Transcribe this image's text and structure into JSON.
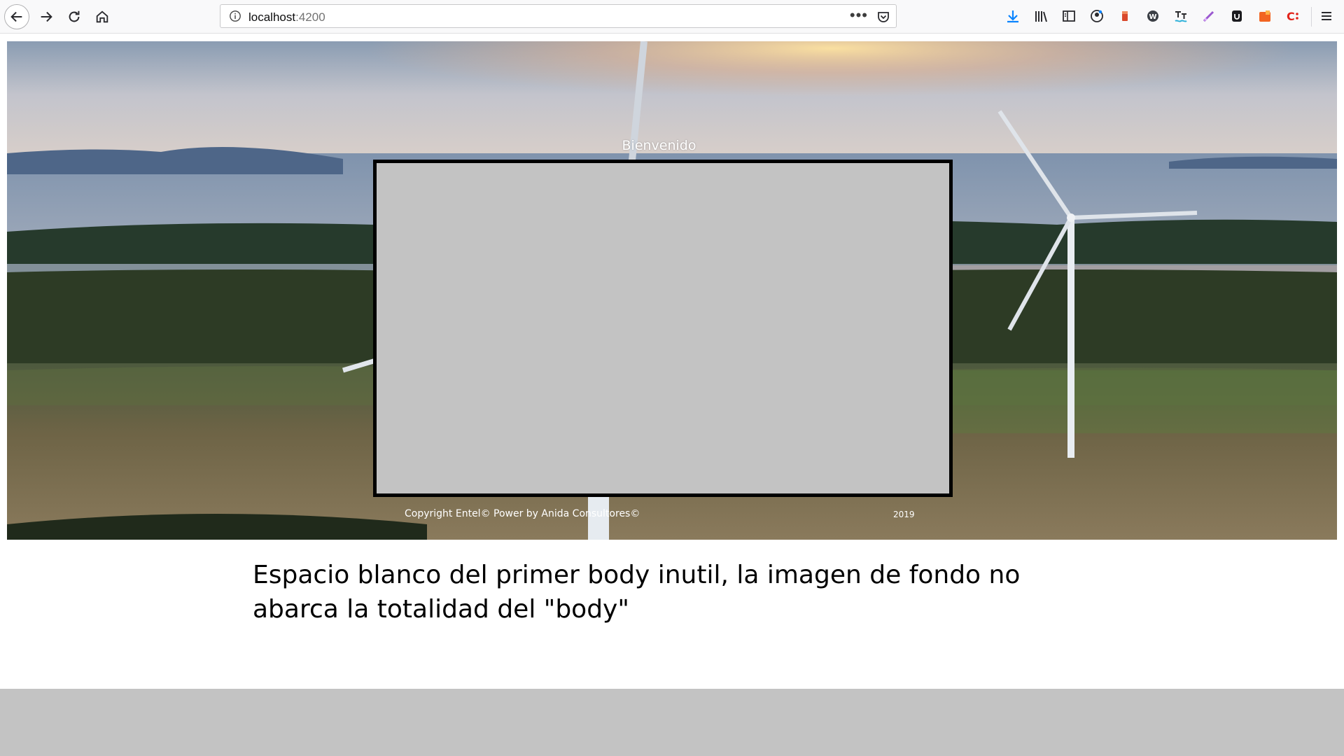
{
  "browser": {
    "url_host": "localhost",
    "url_port": ":4200",
    "icons": {
      "back": "back-arrow-icon",
      "forward": "forward-arrow-icon",
      "reload": "reload-icon",
      "home": "home-icon",
      "info": "info-icon",
      "more": "more-actions-icon",
      "pocket": "pocket-icon",
      "downloads": "download-icon",
      "library": "library-icon",
      "sidebar": "sidebar-icon",
      "account": "account-icon",
      "menu": "hamburger-menu-icon"
    },
    "more_label": "•••"
  },
  "page": {
    "welcome": "Bienvenido",
    "copyright": "Copyright Entel© Power by Anida Consultores©",
    "year": "2019",
    "note": "Espacio blanco del primer body inutil, la imagen de fondo no abarca la totalidad del \"body\"",
    "colors": {
      "panel": "#c3c3c3",
      "panel_border": "#000000",
      "bottom_strip": "#c3c3c3",
      "accent_download": "#0a84ff"
    }
  }
}
